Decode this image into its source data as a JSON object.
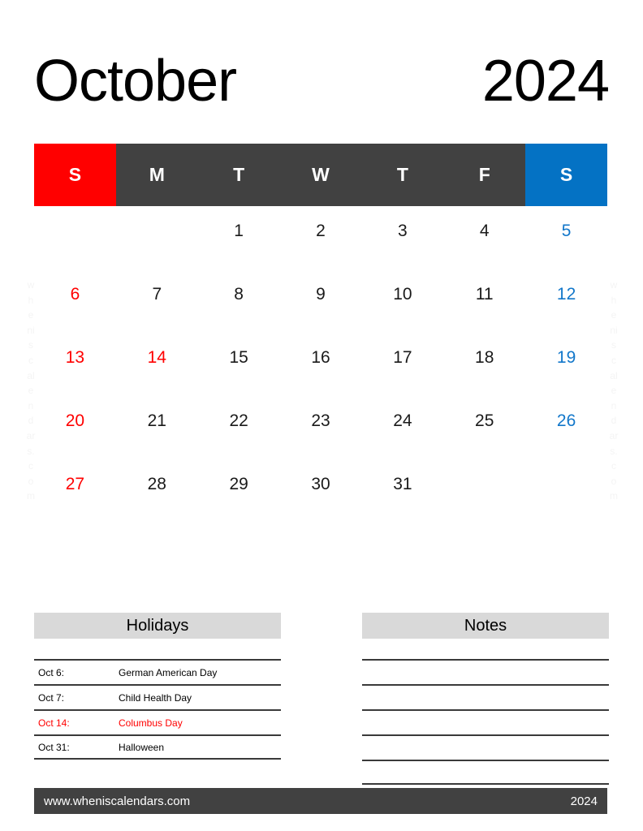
{
  "header": {
    "month": "October",
    "year": "2024"
  },
  "weekdays": [
    {
      "label": "S",
      "kind": "sun"
    },
    {
      "label": "M",
      "kind": "weekday"
    },
    {
      "label": "T",
      "kind": "weekday"
    },
    {
      "label": "W",
      "kind": "weekday"
    },
    {
      "label": "T",
      "kind": "weekday"
    },
    {
      "label": "F",
      "kind": "weekday"
    },
    {
      "label": "S",
      "kind": "sat"
    }
  ],
  "weeks": [
    [
      {
        "day": "",
        "color": "empty"
      },
      {
        "day": "",
        "color": "empty"
      },
      {
        "day": "1",
        "color": "black"
      },
      {
        "day": "2",
        "color": "black"
      },
      {
        "day": "3",
        "color": "black"
      },
      {
        "day": "4",
        "color": "black"
      },
      {
        "day": "5",
        "color": "blue"
      }
    ],
    [
      {
        "day": "6",
        "color": "red"
      },
      {
        "day": "7",
        "color": "black"
      },
      {
        "day": "8",
        "color": "black"
      },
      {
        "day": "9",
        "color": "black"
      },
      {
        "day": "10",
        "color": "black"
      },
      {
        "day": "11",
        "color": "black"
      },
      {
        "day": "12",
        "color": "blue"
      }
    ],
    [
      {
        "day": "13",
        "color": "red"
      },
      {
        "day": "14",
        "color": "red"
      },
      {
        "day": "15",
        "color": "black"
      },
      {
        "day": "16",
        "color": "black"
      },
      {
        "day": "17",
        "color": "black"
      },
      {
        "day": "18",
        "color": "black"
      },
      {
        "day": "19",
        "color": "blue"
      }
    ],
    [
      {
        "day": "20",
        "color": "red"
      },
      {
        "day": "21",
        "color": "black"
      },
      {
        "day": "22",
        "color": "black"
      },
      {
        "day": "23",
        "color": "black"
      },
      {
        "day": "24",
        "color": "black"
      },
      {
        "day": "25",
        "color": "black"
      },
      {
        "day": "26",
        "color": "blue"
      }
    ],
    [
      {
        "day": "27",
        "color": "red"
      },
      {
        "day": "28",
        "color": "black"
      },
      {
        "day": "29",
        "color": "black"
      },
      {
        "day": "30",
        "color": "black"
      },
      {
        "day": "31",
        "color": "black"
      },
      {
        "day": "",
        "color": "empty"
      },
      {
        "day": "",
        "color": "empty"
      }
    ]
  ],
  "holidays": {
    "title": "Holidays",
    "rows": [
      {
        "date": "Oct 6:",
        "name": "German American Day",
        "color": "black"
      },
      {
        "date": "Oct 7:",
        "name": "Child Health Day",
        "color": "black"
      },
      {
        "date": "Oct 14:",
        "name": "Columbus Day",
        "color": "red"
      },
      {
        "date": "Oct 31:",
        "name": "Halloween",
        "color": "black"
      }
    ]
  },
  "notes": {
    "title": "Notes",
    "line_count": 5
  },
  "watermark": {
    "chars": [
      "w",
      "h",
      "e",
      "ni",
      "s",
      "c",
      "al",
      "e",
      "n",
      "d",
      "ar",
      "s.",
      "c",
      "o",
      "m"
    ]
  },
  "footer": {
    "site": "www.wheniscalendars.com",
    "year": "2024"
  },
  "colors": {
    "sunday": "#ff0000",
    "weekday": "#414141",
    "saturday": "#0472c4",
    "saturday_text": "#1277ca",
    "panel_header": "#d9d9d9",
    "rule": "#3a3a3a"
  }
}
